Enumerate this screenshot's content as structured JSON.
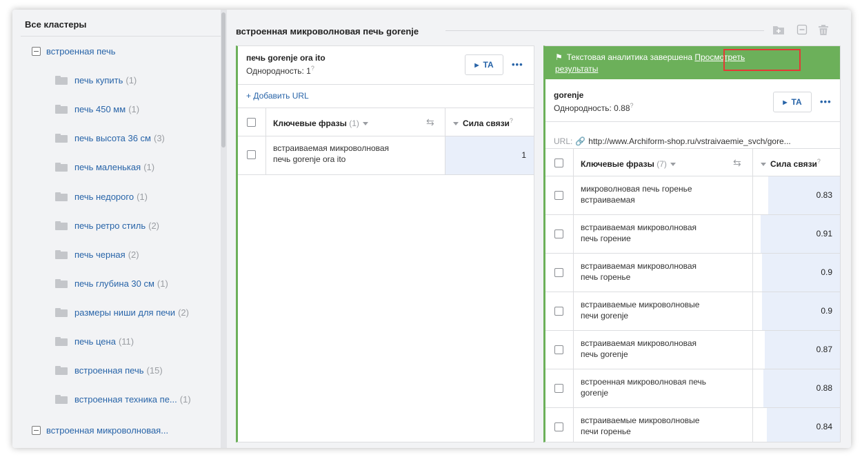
{
  "sidebar": {
    "title": "Все кластеры",
    "groups": [
      {
        "label": "встроенная печь"
      },
      {
        "label": "встроенная микроволновая..."
      }
    ],
    "items": [
      {
        "label": "печь купить",
        "count": "(1)"
      },
      {
        "label": "печь 450 мм",
        "count": "(1)"
      },
      {
        "label": "печь высота 36 см",
        "count": "(3)"
      },
      {
        "label": "печь маленькая",
        "count": "(1)"
      },
      {
        "label": "печь недорого",
        "count": "(1)"
      },
      {
        "label": "печь ретро стиль",
        "count": "(2)"
      },
      {
        "label": "печь черная",
        "count": "(2)"
      },
      {
        "label": "печь глубина 30 см",
        "count": "(1)"
      },
      {
        "label": "размеры ниши для печи",
        "count": "(2)"
      },
      {
        "label": "печь цена",
        "count": "(11)"
      },
      {
        "label": "встроенная печь",
        "count": "(15)"
      },
      {
        "label": "встроенная техника пе...",
        "count": "(1)"
      }
    ]
  },
  "header": {
    "title": "встроенная микроволновая печь gorenje",
    "icons": [
      "folder-add-icon",
      "collapse-icon",
      "trash-icon"
    ]
  },
  "card1": {
    "title": "печь gorenje ora ito",
    "homogeneity_label": "Однородность: 1",
    "hint": "?",
    "ta_label": "TA",
    "more": "•••",
    "add_url": "+ Добавить URL",
    "col_keywords": "Ключевые фразы",
    "col_keywords_count": "(1)",
    "col_strength": "Сила связи",
    "rows": [
      {
        "phrase_line1": "встраиваемая микроволновая",
        "phrase_line2": "печь gorenje ora ito",
        "value": "1"
      }
    ]
  },
  "card2": {
    "banner_text": "Текстовая аналитика завершена",
    "banner_link_a": "Просмотреть",
    "banner_link_b": "результаты",
    "title": "gorenje",
    "homogeneity_label": "Однородность: 0.88",
    "hint": "?",
    "ta_label": "TA",
    "more": "•••",
    "url_label": "URL:",
    "url": "http://www.Archiform-shop.ru/vstraivaemie_svch/gore...",
    "col_keywords": "Ключевые фразы",
    "col_keywords_count": "(7)",
    "col_strength": "Сила связи",
    "rows": [
      {
        "phrase_line1": "микроволновая печь горенье",
        "phrase_line2": "встраиваемая",
        "value": "0.83"
      },
      {
        "phrase_line1": "встраиваемая микроволновая",
        "phrase_line2": "печь горение",
        "value": "0.91"
      },
      {
        "phrase_line1": "встраиваемая микроволновая",
        "phrase_line2": "печь горенье",
        "value": "0.9"
      },
      {
        "phrase_line1": "встраиваемые микроволновые",
        "phrase_line2": "печи gorenje",
        "value": "0.9"
      },
      {
        "phrase_line1": "встраиваемая микроволновая",
        "phrase_line2": "печь gorenje",
        "value": "0.87"
      },
      {
        "phrase_line1": "встроенная микроволновая печь",
        "phrase_line2": "gorenje",
        "value": "0.88"
      },
      {
        "phrase_line1": "встраиваемые микроволновые",
        "phrase_line2": "печи горенье",
        "value": "0.84"
      }
    ]
  },
  "colors": {
    "accent": "#6cb05a",
    "link": "#2864a8",
    "highlight": "#e53935",
    "bar": "#e9effa"
  }
}
